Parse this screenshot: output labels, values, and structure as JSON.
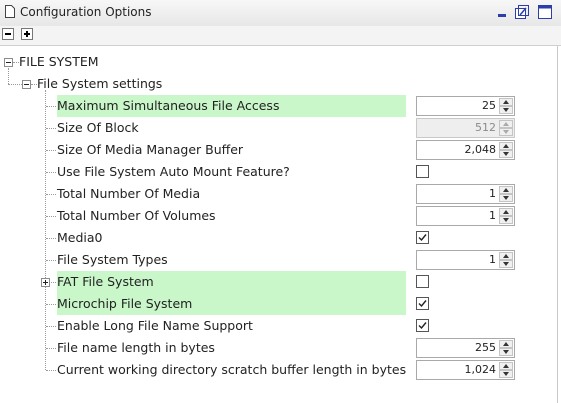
{
  "window": {
    "title": "Configuration Options",
    "icons": [
      "page-icon",
      "minimize-icon",
      "restore-icon",
      "maximize-icon"
    ]
  },
  "toolbar": {
    "collapse_all_icon": "minus-box-icon",
    "expand_all_icon": "plus-box-icon"
  },
  "tree": {
    "root": {
      "label": "FILE SYSTEM",
      "expanded": true
    },
    "group": {
      "label": "File System settings",
      "expanded": true
    },
    "options": [
      {
        "label": "Maximum Simultaneous File Access",
        "control": "spinner",
        "value": "25",
        "highlighted": true
      },
      {
        "label": "Size Of Block",
        "control": "spinner",
        "value": "512",
        "disabled": true
      },
      {
        "label": "Size Of Media Manager Buffer",
        "control": "spinner",
        "value": "2,048"
      },
      {
        "label": "Use File System Auto Mount Feature?",
        "control": "checkbox",
        "checked": false
      },
      {
        "label": "Total Number Of Media",
        "control": "spinner",
        "value": "1"
      },
      {
        "label": "Total Number Of Volumes",
        "control": "spinner",
        "value": "1"
      },
      {
        "label": "Media0",
        "control": "checkbox",
        "checked": true
      },
      {
        "label": "File System Types",
        "control": "spinner",
        "value": "1"
      },
      {
        "label": "FAT File System",
        "control": "checkbox",
        "checked": false,
        "highlighted": true,
        "expandable": true
      },
      {
        "label": "Microchip File System",
        "control": "checkbox",
        "checked": true,
        "highlighted": true
      },
      {
        "label": "Enable Long File Name Support",
        "control": "checkbox",
        "checked": true
      },
      {
        "label": "File name length in bytes",
        "control": "spinner",
        "value": "255"
      },
      {
        "label": "Current working directory scratch buffer length in bytes",
        "control": "spinner",
        "value": "1,024"
      }
    ]
  },
  "colors": {
    "highlight": "#c9f7c9",
    "titlebar": "#eeeeee",
    "accent": "#2c3ea8"
  }
}
